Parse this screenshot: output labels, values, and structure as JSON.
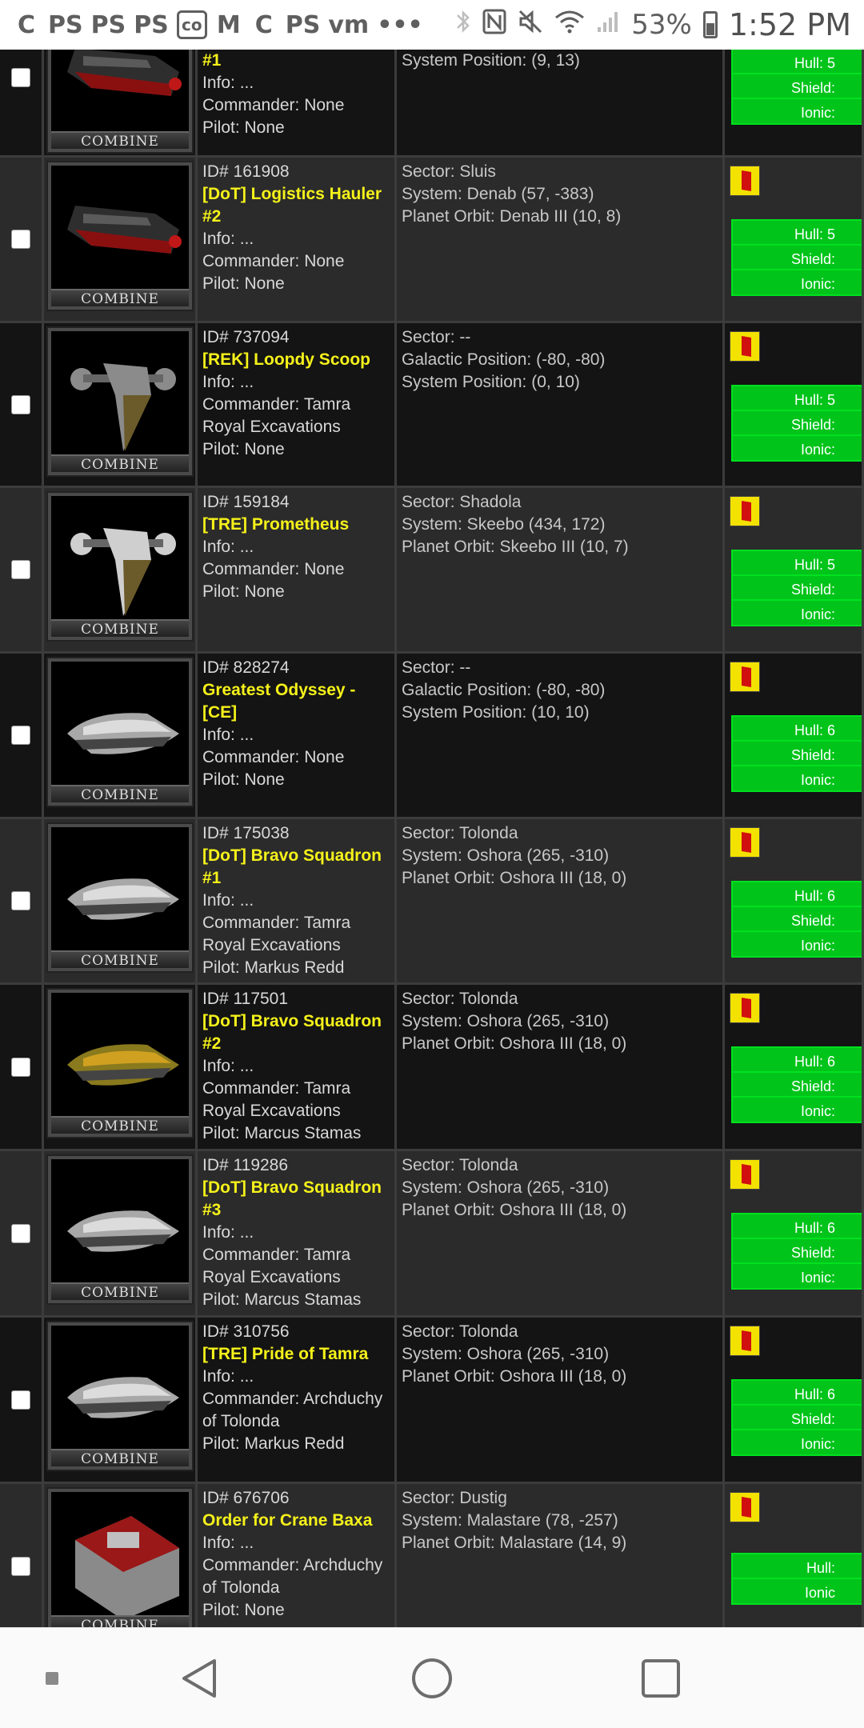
{
  "status_bar": {
    "notification_icons": [
      "C",
      "PS",
      "PS",
      "PS",
      "co",
      "M",
      "C",
      "PS",
      "vm",
      "•••"
    ],
    "battery_percent": "53%",
    "time": "1:52 PM"
  },
  "logo_text": "COMBINE",
  "stat_labels": {
    "hull": "Hull:",
    "shield": "Shield:",
    "ionic": "Ionic:"
  },
  "rows": [
    {
      "id": "",
      "name": "#1",
      "info": "Info: ...",
      "commander": "Commander: None",
      "pilot": "Pilot: None",
      "loc": [
        "",
        "",
        "System Position: (9, 13)"
      ],
      "bars": [
        "Hull: 5",
        "Shield:",
        "Ionic:"
      ],
      "flag": false
    },
    {
      "id": "ID# 161908",
      "name": "[DoT] Logistics Hauler #2",
      "info": "Info: ...",
      "commander": "Commander: None",
      "pilot": "Pilot: None",
      "loc": [
        "Sector: Sluis",
        "System: Denab (57, -383)",
        "Planet Orbit: Denab III (10, 8)"
      ],
      "bars": [
        "Hull: 5",
        "Shield:",
        "Ionic:"
      ],
      "flag": true
    },
    {
      "id": "ID# 737094",
      "name": "[REK] Loopdy Scoop",
      "info": "Info: ...",
      "commander": "Commander: Tamra Royal Excavations",
      "pilot": "Pilot: None",
      "loc": [
        "Sector: --",
        "Galactic Position: (-80, -80)",
        "System Position: (0, 10)"
      ],
      "bars": [
        "Hull: 5",
        "Shield:",
        "Ionic:"
      ],
      "flag": true
    },
    {
      "id": "ID# 159184",
      "name": "[TRE] Prometheus",
      "info": "Info: ...",
      "commander": "Commander: None",
      "pilot": "Pilot: None",
      "loc": [
        "Sector: Shadola",
        "System: Skeebo (434, 172)",
        "Planet Orbit: Skeebo III (10, 7)"
      ],
      "bars": [
        "Hull: 5",
        "Shield:",
        "Ionic:"
      ],
      "flag": true
    },
    {
      "id": "ID# 828274",
      "name": "Greatest Odyssey - [CE]",
      "info": "Info: ...",
      "commander": "Commander: None",
      "pilot": "Pilot: None",
      "loc": [
        "Sector: --",
        "Galactic Position: (-80, -80)",
        "System Position: (10, 10)"
      ],
      "bars": [
        "Hull: 6",
        "Shield:",
        "Ionic:"
      ],
      "flag": true
    },
    {
      "id": "ID# 175038",
      "name": "[DoT] Bravo Squadron #1",
      "info": "Info: ...",
      "commander": "Commander: Tamra Royal Excavations",
      "pilot": "Pilot: Markus Redd",
      "loc": [
        "Sector: Tolonda",
        "System: Oshora (265, -310)",
        "Planet Orbit: Oshora III (18, 0)"
      ],
      "bars": [
        "Hull: 6",
        "Shield:",
        "Ionic:"
      ],
      "flag": true
    },
    {
      "id": "ID# 117501",
      "name": "[DoT] Bravo Squadron #2",
      "info": "Info: ...",
      "commander": "Commander: Tamra Royal Excavations",
      "pilot": "Pilot: Marcus Stamas",
      "loc": [
        "Sector: Tolonda",
        "System: Oshora (265, -310)",
        "Planet Orbit: Oshora III (18, 0)"
      ],
      "bars": [
        "Hull: 6",
        "Shield:",
        "Ionic:"
      ],
      "flag": true
    },
    {
      "id": "ID# 119286",
      "name": "[DoT] Bravo Squadron #3",
      "info": "Info: ...",
      "commander": "Commander: Tamra Royal Excavations",
      "pilot": "Pilot: Marcus Stamas",
      "loc": [
        "Sector: Tolonda",
        "System: Oshora (265, -310)",
        "Planet Orbit: Oshora III (18, 0)"
      ],
      "bars": [
        "Hull: 6",
        "Shield:",
        "Ionic:"
      ],
      "flag": true
    },
    {
      "id": "ID# 310756",
      "name": "[TRE] Pride of Tamra",
      "info": "Info: ...",
      "commander": "Commander: Archduchy of Tolonda",
      "pilot": "Pilot: Markus Redd",
      "loc": [
        "Sector: Tolonda",
        "System: Oshora (265, -310)",
        "Planet Orbit: Oshora III (18, 0)"
      ],
      "bars": [
        "Hull: 6",
        "Shield:",
        "Ionic:"
      ],
      "flag": true
    },
    {
      "id": "ID# 676706",
      "name": "Order for Crane Baxa",
      "info": "Info: ...",
      "commander": "Commander: Archduchy of Tolonda",
      "pilot": "Pilot: None",
      "loc": [
        "Sector: Dustig",
        "System: Malastare (78, -257)",
        "Planet Orbit: Malastare (14, 9)"
      ],
      "bars": [
        "Hull:",
        "Ionic"
      ],
      "flag": true
    }
  ],
  "nav": {
    "recents_label": "recents",
    "home_label": "home",
    "back_label": "back"
  }
}
